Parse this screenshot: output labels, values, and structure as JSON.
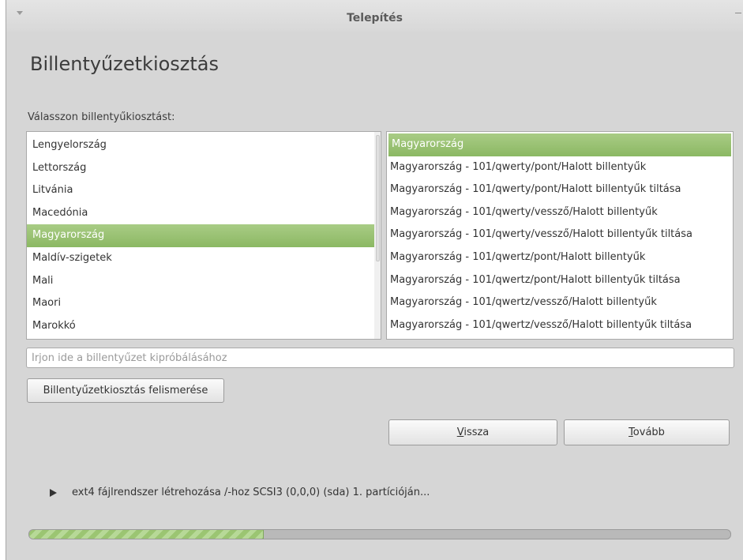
{
  "window": {
    "title": "Telepítés"
  },
  "page": {
    "heading": "Billentyűzetkiosztás",
    "prompt": "Válasszon billentyűkiosztást:"
  },
  "layout_list": {
    "items": [
      "Lengyelország",
      "Lettország",
      "Litvánia",
      "Macedónia",
      "Magyarország",
      "Maldív-szigetek",
      "Mali",
      "Maori",
      "Marokkó"
    ],
    "selected_index": 4
  },
  "variant_list": {
    "items": [
      "Magyarország",
      "Magyarország - 101/qwerty/pont/Halott billentyűk",
      "Magyarország - 101/qwerty/pont/Halott billentyűk tiltása",
      "Magyarország - 101/qwerty/vessző/Halott billentyűk",
      "Magyarország - 101/qwerty/vessző/Halott billentyűk tiltása",
      "Magyarország - 101/qwertz/pont/Halott billentyűk",
      "Magyarország - 101/qwertz/pont/Halott billentyűk tiltása",
      "Magyarország - 101/qwertz/vessző/Halott billentyűk",
      "Magyarország - 101/qwertz/vessző/Halott billentyűk tiltása"
    ],
    "selected_index": 0
  },
  "test_input": {
    "placeholder": "Írjon ide a billentyűzet kipróbálásához",
    "value": ""
  },
  "buttons": {
    "detect": "Billentyűzetkiosztás felismerése",
    "back_mnemonic": "V",
    "back_rest": "issza",
    "next_mnemonic": "T",
    "next_rest": "ovább"
  },
  "status": {
    "text": "ext4 fájlrendszer létrehozása /-hoz SCSI3 (0,0,0) (sda) 1. partícióján..."
  },
  "progress": {
    "fraction": 0.335
  },
  "colors": {
    "selection": "#95be6c",
    "progress": "#9bc572",
    "window_bg": "#d6d6d6"
  },
  "icons": {
    "titlebar_menu": "chevron-down-icon",
    "titlebar_minimize": "minimize-icon",
    "status_expander": "triangle-right-icon"
  }
}
